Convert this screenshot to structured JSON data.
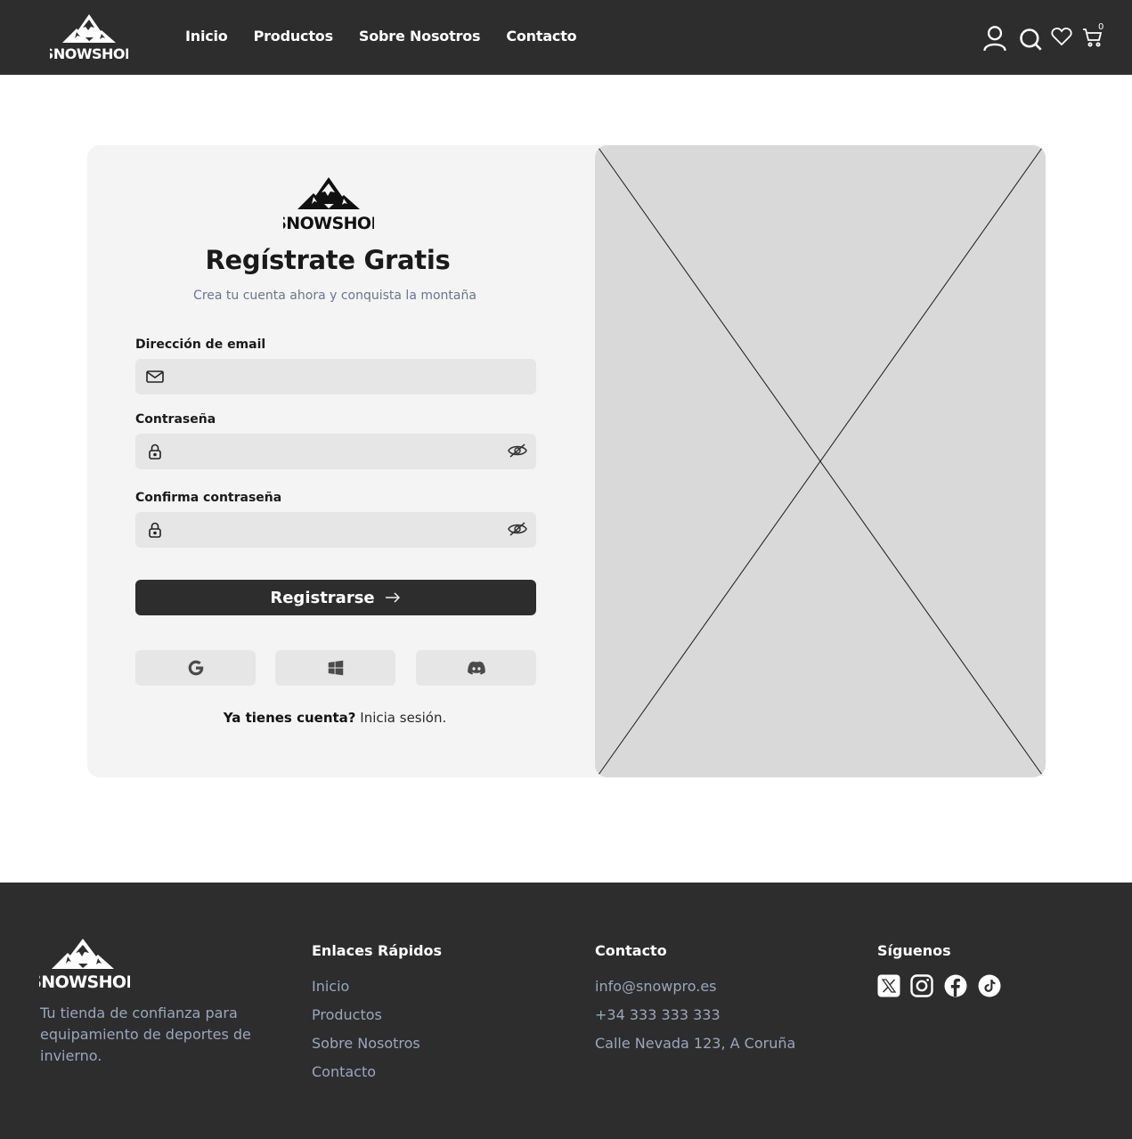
{
  "brand": {
    "name": "SNOWSHOP"
  },
  "header": {
    "nav": [
      "Inicio",
      "Productos",
      "Sobre Nosotros",
      "Contacto"
    ],
    "icons": [
      "user-icon",
      "search-icon",
      "heart-icon",
      "cart-icon"
    ],
    "cart_count": "0"
  },
  "form": {
    "title": "Regístrate Gratis",
    "subtitle": "Crea tu cuenta ahora y conquista la montaña",
    "email_label": "Dirección de email",
    "email_value": "",
    "password_label": "Contraseña",
    "password_value": "",
    "confirm_label": "Confirma contraseña",
    "confirm_value": "",
    "register_label": "Registrarse",
    "social": [
      "google-icon",
      "windows-icon",
      "discord-icon"
    ],
    "have_account": "Ya tienes cuenta?",
    "login_link": "Inicia sesión."
  },
  "footer": {
    "tagline": "Tu tienda de confianza para equipamiento de deportes de invierno.",
    "quick_links_title": "Enlaces Rápidos",
    "quick_links": [
      "Inicio",
      "Productos",
      "Sobre Nosotros",
      "Contacto"
    ],
    "contact_title": "Contacto",
    "contact": [
      "info@snowpro.es",
      "+34 333 333 333",
      "Calle Nevada 123, A Coruña"
    ],
    "follow_title": "Síguenos",
    "social_icons": [
      "x-icon",
      "instagram-icon",
      "facebook-icon",
      "tiktok-icon"
    ]
  },
  "colors": {
    "dark": "#2d2d2d",
    "muted": "#9ba6bd",
    "input_bg": "#e6e6e6",
    "card_bg": "#f4f4f4",
    "placeholder_bg": "#d9d9d9"
  }
}
